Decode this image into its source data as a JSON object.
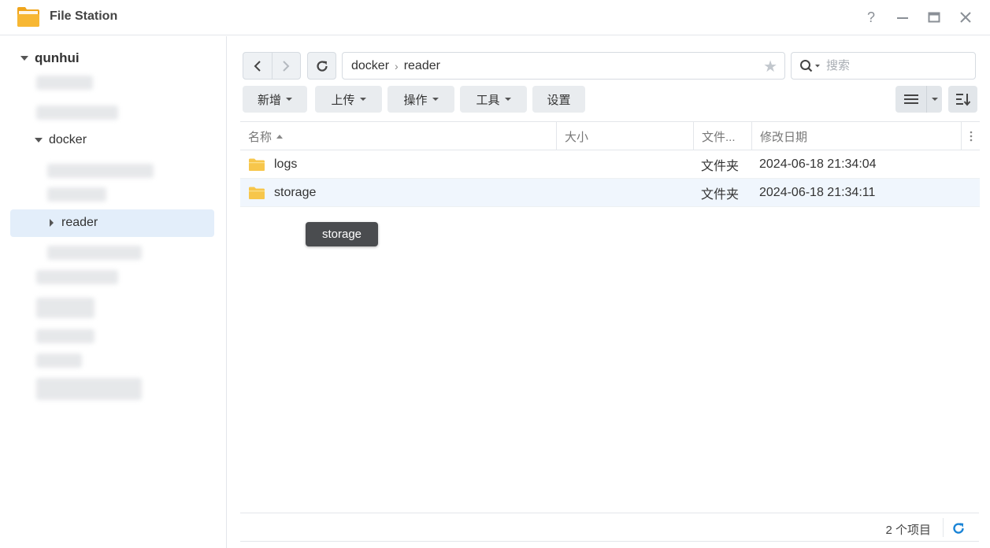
{
  "window": {
    "title": "File Station",
    "help_icon": "help-icon",
    "minimize_icon": "minimize-icon",
    "maximize_icon": "maximize-icon",
    "close_icon": "close-icon"
  },
  "sidebar": {
    "root_label": "qunhui",
    "folders": [
      {
        "label": "docker",
        "expanded": true
      },
      {
        "label": "reader",
        "selected": true,
        "collapsed": true
      }
    ]
  },
  "toolbar": {
    "path": [
      "docker",
      "reader"
    ],
    "search_placeholder": "搜索",
    "buttons": [
      {
        "label": "新增",
        "dropdown": true
      },
      {
        "label": "上传",
        "dropdown": true
      },
      {
        "label": "操作",
        "dropdown": true
      },
      {
        "label": "工具",
        "dropdown": true
      },
      {
        "label": "设置",
        "dropdown": false
      }
    ]
  },
  "table": {
    "columns": [
      "名称",
      "大小",
      "文件...",
      "修改日期"
    ],
    "sort_column": "名称",
    "rows": [
      {
        "name": "logs",
        "size": "",
        "type": "文件夹",
        "modified": "2024-06-18 21:34:04"
      },
      {
        "name": "storage",
        "size": "",
        "type": "文件夹",
        "modified": "2024-06-18 21:34:11",
        "hover": true
      }
    ]
  },
  "tooltip": {
    "text": "storage"
  },
  "status": {
    "item_count": "2 个项目"
  },
  "colors": {
    "accent": "#1a84d6",
    "folder": "#f7c64b",
    "selected_bg": "#e3eefa",
    "tooltip_bg": "#4a4c4f"
  }
}
